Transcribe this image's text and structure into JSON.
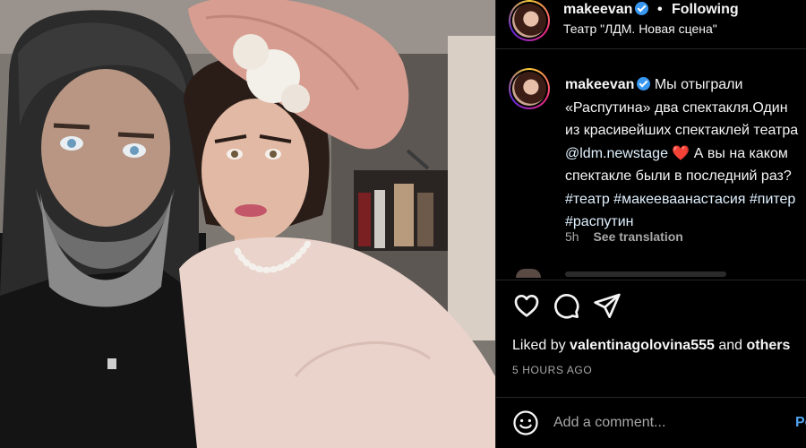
{
  "post": {
    "username": "makeevan",
    "verified": true,
    "follow_separator": "•",
    "follow_status": "Following",
    "location": "Театр \"ЛДМ. Новая сцена\"",
    "caption": {
      "username": "makeevan",
      "text_before_link": "Мы отыграли «Распутина» два спектакля.Один из красивейших спектаклей театра ",
      "mention": "@ldm.newstage",
      "heart": "❤️",
      "text_after_link": " А вы на каком спектакле были в последний раз? ",
      "hashtags": "#театр #макееваанастасия #питер #распутин",
      "time": "5h",
      "see_translation": "See translation"
    },
    "actions": {
      "like_icon": "heart-outline-icon",
      "comment_icon": "comment-bubble-icon",
      "share_icon": "paper-plane-icon"
    },
    "likes": {
      "prefix": "Liked by",
      "user": "valentinagolovina555",
      "conj": "and",
      "others": "others"
    },
    "timestamp": "5 HOURS AGO",
    "comment": {
      "emoji_icon": "smiley-icon",
      "placeholder": "Add a comment...",
      "post_label": "Post"
    }
  },
  "colors": {
    "background": "#000000",
    "divider": "#262626",
    "secondary_text": "#a8a8a8",
    "verified": "#3897f0",
    "link": "#e0f1ff",
    "post_button": "#4fa3f0"
  }
}
